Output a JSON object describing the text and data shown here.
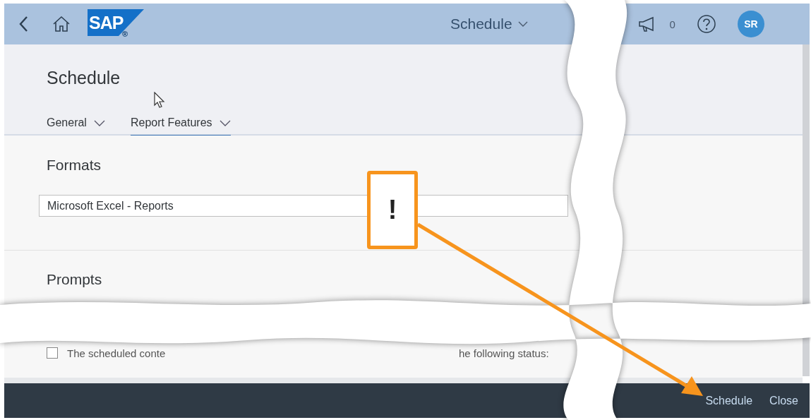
{
  "shell": {
    "logo": "SAP",
    "logo_mark": "®",
    "title": "Schedule",
    "notifications": "0",
    "avatar": "SR"
  },
  "page": {
    "title": "Schedule",
    "tabs": [
      {
        "label": "General",
        "selected": false
      },
      {
        "label": "Report Features",
        "selected": true
      }
    ]
  },
  "sections": [
    {
      "title": "Formats",
      "field_value": "Microsoft Excel - Reports"
    },
    {
      "title": "Prompts"
    }
  ],
  "option": {
    "checked": false,
    "text_start": "The scheduled conte",
    "text_end": "he following status:"
  },
  "footer": {
    "buttons": [
      "Schedule",
      "Close"
    ]
  },
  "callout": {
    "mark": "!"
  }
}
